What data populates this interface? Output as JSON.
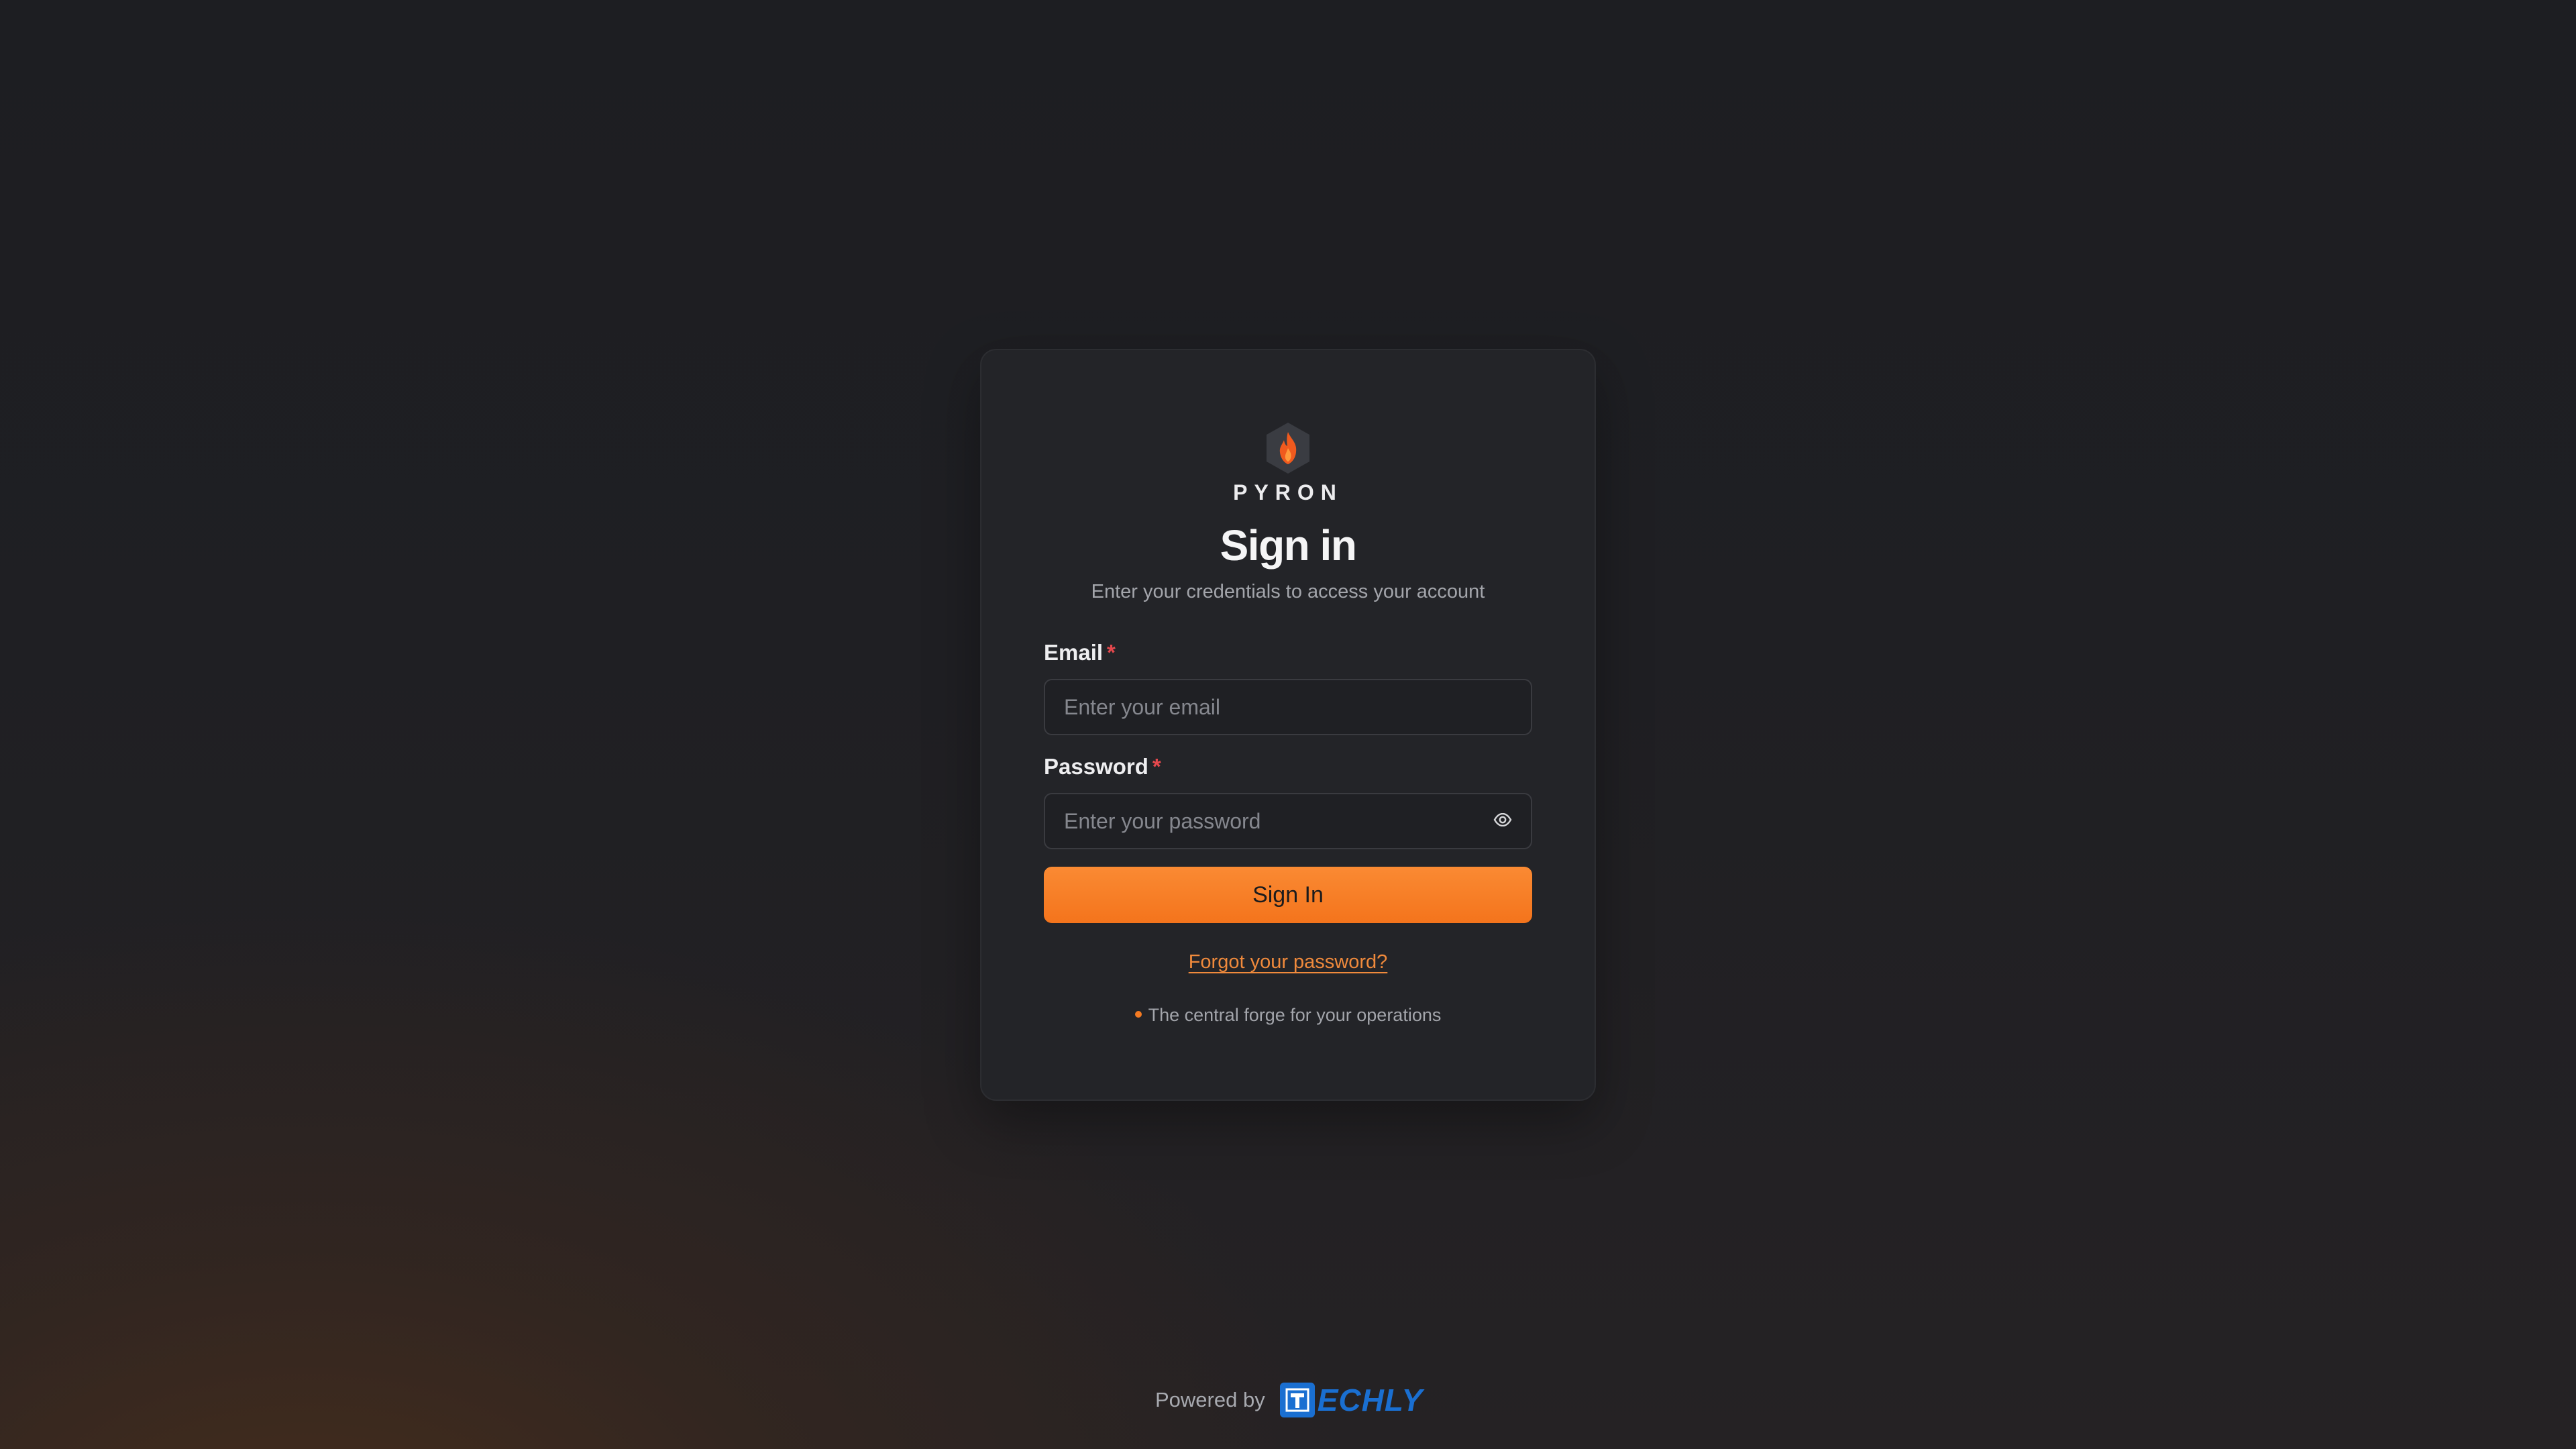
{
  "brand": {
    "name": "PYRON",
    "logo_icon": "flame-hexagon-icon",
    "accent_color": "#f47a22"
  },
  "form": {
    "title": "Sign in",
    "subtitle": "Enter your credentials to access your account",
    "email": {
      "label": "Email",
      "required_mark": "*",
      "placeholder": "Enter your email",
      "value": ""
    },
    "password": {
      "label": "Password",
      "required_mark": "*",
      "placeholder": "Enter your password",
      "value": "",
      "toggle_icon": "eye-icon"
    },
    "submit_label": "Sign In",
    "forgot_link": "Forgot your password?",
    "tagline": "The central forge for your operations"
  },
  "footer": {
    "powered_by": "Powered by",
    "partner_logo_letter": "T",
    "partner_logo_word": "ECHLY",
    "partner_color": "#1a6fd1"
  }
}
